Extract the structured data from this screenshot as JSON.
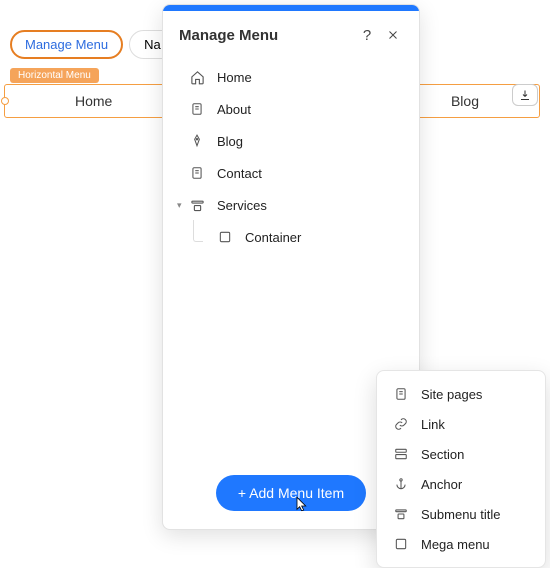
{
  "toolbar": {
    "manage_menu_label": "Manage Menu",
    "nav_label": "Na"
  },
  "page_tag": "Horizontal Menu",
  "menu_bar": {
    "left_item": "Home",
    "right_item": "Blog"
  },
  "panel": {
    "title": "Manage Menu",
    "items": [
      {
        "icon": "home-icon",
        "label": "Home"
      },
      {
        "icon": "page-icon",
        "label": "About"
      },
      {
        "icon": "pen-icon",
        "label": "Blog"
      },
      {
        "icon": "page-icon",
        "label": "Contact"
      },
      {
        "icon": "submenu-icon",
        "label": "Services",
        "expanded": true
      },
      {
        "icon": "square-icon",
        "label": "Container",
        "sub": true
      }
    ],
    "add_btn_label": "+ Add Menu Item"
  },
  "flyout": {
    "items": [
      {
        "icon": "page-icon",
        "label": "Site pages"
      },
      {
        "icon": "link-icon",
        "label": "Link"
      },
      {
        "icon": "section-icon",
        "label": "Section"
      },
      {
        "icon": "anchor-icon",
        "label": "Anchor"
      },
      {
        "icon": "submenu-icon",
        "label": "Submenu title"
      },
      {
        "icon": "square-icon",
        "label": "Mega menu"
      }
    ]
  }
}
